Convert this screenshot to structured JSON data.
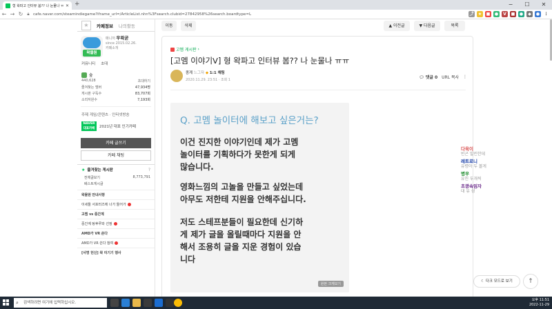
{
  "browser": {
    "tab_title": "형 왁파고 인터뷰 봄?? 나 눈물나 ㅠㅠ",
    "url": "cafe.naver.com/steamindiegame?iframe_url=/ArticleList.nhn%3Fsearch.clubid=27842958%26search.boardtype=L",
    "new_tab": "+",
    "window_controls": [
      "−",
      "☐",
      "✕"
    ]
  },
  "cafe": {
    "tab_info": "카페정보",
    "tab_activity": "나의활동",
    "cafe_name": "우왁굳",
    "manager_label": "매니저",
    "since": "since 2015.02.26.",
    "intro_link": "카페소개",
    "avatar_text": "왁물원",
    "links": [
      "커뮤니티",
      "초대"
    ],
    "level": "숲",
    "member_count": "440,628",
    "invite": "초대하기",
    "stats": [
      {
        "label": "즐겨찾는 멤버",
        "value": "47,934명"
      },
      {
        "label": "게시판 구독수",
        "value": "83,707회"
      },
      {
        "label": "소리자원수",
        "value": "7,193회"
      }
    ],
    "topic": "주제 게임/콘텐츠 · 인터넷방송",
    "award_badge": "NAVER 대표카페",
    "award_text": "2021년 대표 인기카페",
    "write_button": "카페 글쓰기",
    "chat_button": "카페 채팅",
    "fav_board_title": "즐겨찾는 게시판",
    "fav_boards": [
      {
        "name": "전체글보기",
        "count": "8,773,791"
      },
      {
        "name": "베스트게시글",
        "count": ""
      }
    ],
    "sections": [
      {
        "title": "왁물원 안내사항"
      },
      {
        "title": "이세돌 서포터즈에 너가 들어가"
      },
      {
        "title": "고멤 vs 중간계"
      },
      {
        "title": "중간계 탕후루와 선정"
      },
      {
        "title": "AMD가 VR 쏜다"
      },
      {
        "title": "AMD가 VR 쏜다 참여"
      },
      {
        "title": "[사명 헌신] 왁 이기기 행사"
      }
    ]
  },
  "toolbar": {
    "move": "이동",
    "delete": "삭제",
    "prev": "이전글",
    "next": "다음글",
    "list": "목록"
  },
  "post": {
    "board": "고멤 게시판",
    "title": "[고멤 이야기ᐯ] 형 왁파고 인터뷰 봄?? 나 눈물나 ㅠㅠ",
    "author": "종계",
    "author_level": "느그자",
    "badge": "1:1 채팅",
    "meta": "2020.11.29. 23:51 · 조회 1",
    "comment": "댓글 0",
    "url_copy": "URL 복사",
    "slide_question": "Q. 고멤 놀이터에 해보고 싶은거는?",
    "slide_lines": [
      "이건 진지한 이야기인데 제가 고멤",
      "놀이터를 기획하다가 못한게 되게",
      "많습니다.",
      "영화느낌의 고놀을 만들고 싶었는데",
      "아무도 저한테 지원을 안해주십니다.",
      "저도 스테프분들이 필요한데 신기하",
      "게 제가 글을 올릴때마다 지원을 안",
      "해서 조용히 글을 지운 경험이 있습",
      "니다"
    ],
    "slide_badge": "원본 크게보기"
  },
  "chat": [
    {
      "name": "다육이",
      "msg": "빈곤 말린한데",
      "color": "#d95050"
    },
    {
      "name": "레트로니",
      "msg": "유령아 두 볼게",
      "color": "#1a3fa8"
    },
    {
      "name": "병우",
      "msg": "유진 두개씩",
      "color": "#1a8a2a"
    },
    {
      "name": "초광속임자",
      "msg": "대 유 성",
      "color": "#6a2a8a"
    }
  ],
  "floating": {
    "dark_mode": "다크 모드로 보기",
    "top": "↑"
  },
  "taskbar": {
    "search_placeholder": "검색하려면 여기에 입력하십시오.",
    "time": "오후 11:51",
    "date": "2022-11-29"
  }
}
